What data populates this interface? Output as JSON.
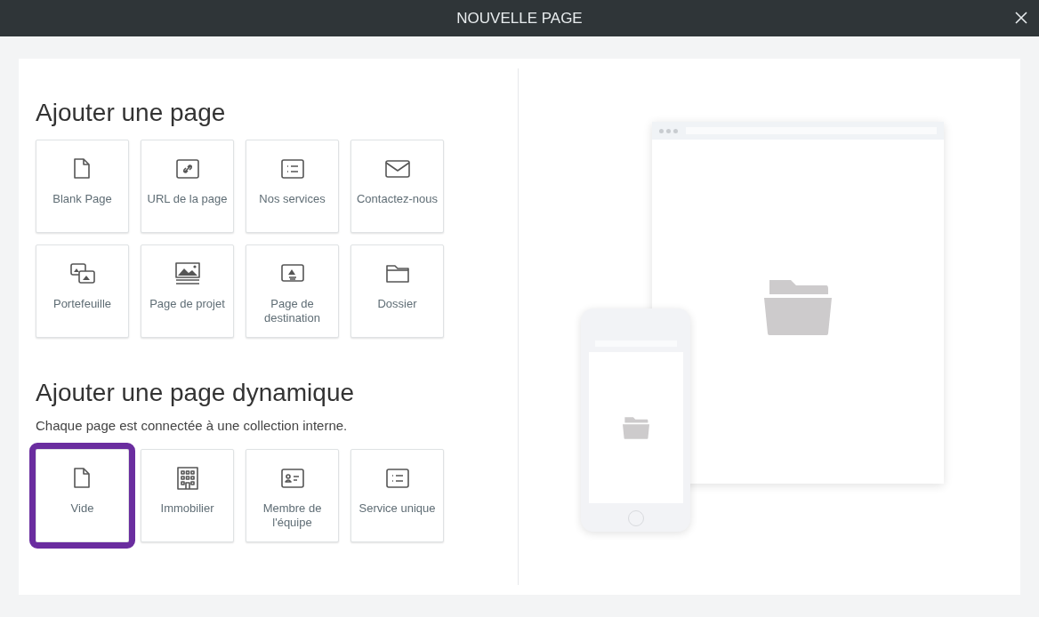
{
  "dialog": {
    "title": "NOUVELLE PAGE"
  },
  "sections": [
    {
      "heading": "Ajouter une page",
      "tiles": [
        {
          "label": "Blank Page",
          "selected": false
        },
        {
          "label": "URL de la page",
          "selected": false
        },
        {
          "label": "Nos services",
          "selected": false
        },
        {
          "label": "Contactez-nous",
          "selected": false
        },
        {
          "label": "Portefeuille",
          "selected": false
        },
        {
          "label": "Page de projet",
          "selected": false
        },
        {
          "label": "Page de destination",
          "selected": false
        },
        {
          "label": "Dossier",
          "selected": false
        }
      ]
    },
    {
      "heading": "Ajouter une page dynamique",
      "subtitle": "Chaque page est connectée à une collection interne.",
      "tiles": [
        {
          "label": "Vide",
          "selected": true
        },
        {
          "label": "Immobilier",
          "selected": false
        },
        {
          "label": "Membre de l'équipe",
          "selected": false
        },
        {
          "label": "Service unique",
          "selected": false
        }
      ]
    }
  ]
}
